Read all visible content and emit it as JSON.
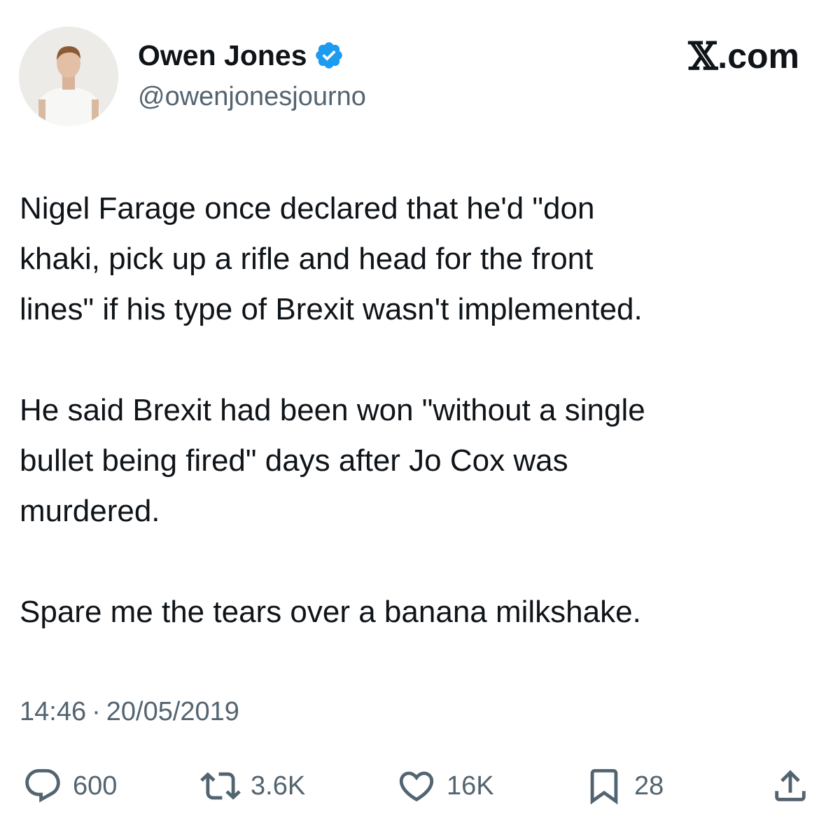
{
  "brand": {
    "x_glyph": "𝕏",
    "suffix": ".com"
  },
  "author": {
    "display_name": "Owen Jones",
    "handle": "@owenjonesjourno",
    "verified": true
  },
  "tweet": {
    "lines": [
      "Nigel Farage once declared that he'd \"don",
      "khaki, pick up a rifle and head for the front",
      "lines\" if his type of Brexit wasn't implemented.",
      "",
      "He said Brexit had been won \"without a single",
      "bullet being fired\" days after Jo Cox was",
      "murdered.",
      "",
      "Spare me the tears over a banana milkshake."
    ],
    "time": "14:46",
    "separator": "·",
    "date": "20/05/2019"
  },
  "actions": {
    "replies": "600",
    "reposts": "3.6K",
    "likes": "16K",
    "bookmarks": "28"
  },
  "icons": {
    "reply": "speech-bubble-icon",
    "repost": "repost-arrows-icon",
    "like": "heart-icon",
    "bookmark": "bookmark-icon",
    "share": "share-upload-icon",
    "verified": "verified-badge-icon"
  },
  "colors": {
    "text": "#0f1419",
    "secondary": "#536471",
    "verified_blue": "#1d9bf0",
    "background": "#ffffff"
  }
}
